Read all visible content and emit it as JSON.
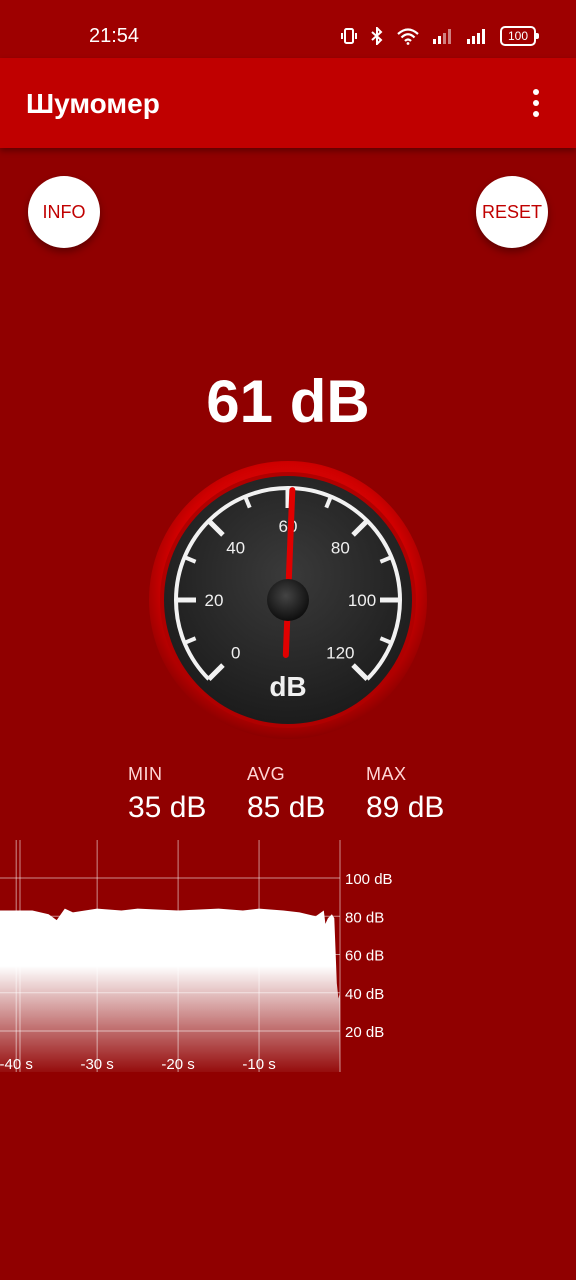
{
  "status_bar": {
    "time": "21:54",
    "battery": "100"
  },
  "app_bar": {
    "title": "Шумомер"
  },
  "buttons": {
    "info": "INFO",
    "reset": "RESET"
  },
  "reading": {
    "value": "61 dB",
    "needle_db": 61
  },
  "gauge": {
    "unit": "dB",
    "scale_labels": [
      "0",
      "20",
      "40",
      "60",
      "80",
      "100",
      "120"
    ],
    "range": [
      0,
      120
    ]
  },
  "stats": {
    "min": {
      "label": "MIN",
      "value": "35 dB"
    },
    "avg": {
      "label": "AVG",
      "value": "85 dB"
    },
    "max": {
      "label": "MAX",
      "value": "89 dB"
    }
  },
  "chart_data": {
    "type": "area",
    "y_tick_labels": [
      "100 dB",
      "80 dB",
      "60 dB",
      "40 dB",
      "20 dB"
    ],
    "x_tick_labels": [
      "-40 s",
      "-30 s",
      "-20 s",
      "-10 s"
    ],
    "ylim": [
      0,
      110
    ],
    "xlim": [
      -42,
      0
    ],
    "x": [
      -42,
      -38,
      -36,
      -35,
      -34,
      -33,
      -30,
      -27,
      -25,
      -20,
      -15,
      -12,
      -10,
      -7,
      -5,
      -3,
      -2,
      -1.8,
      -1.5,
      -1,
      -0.7,
      -0.4,
      -0.2,
      0
    ],
    "y": [
      83,
      83,
      81,
      78,
      84,
      82,
      84,
      83,
      84,
      83,
      84,
      83,
      84,
      83,
      82,
      80,
      83,
      76,
      79,
      81,
      79,
      45,
      37,
      40
    ],
    "colors": {
      "fill": "#ffffff",
      "grid": "#ffffff"
    }
  }
}
